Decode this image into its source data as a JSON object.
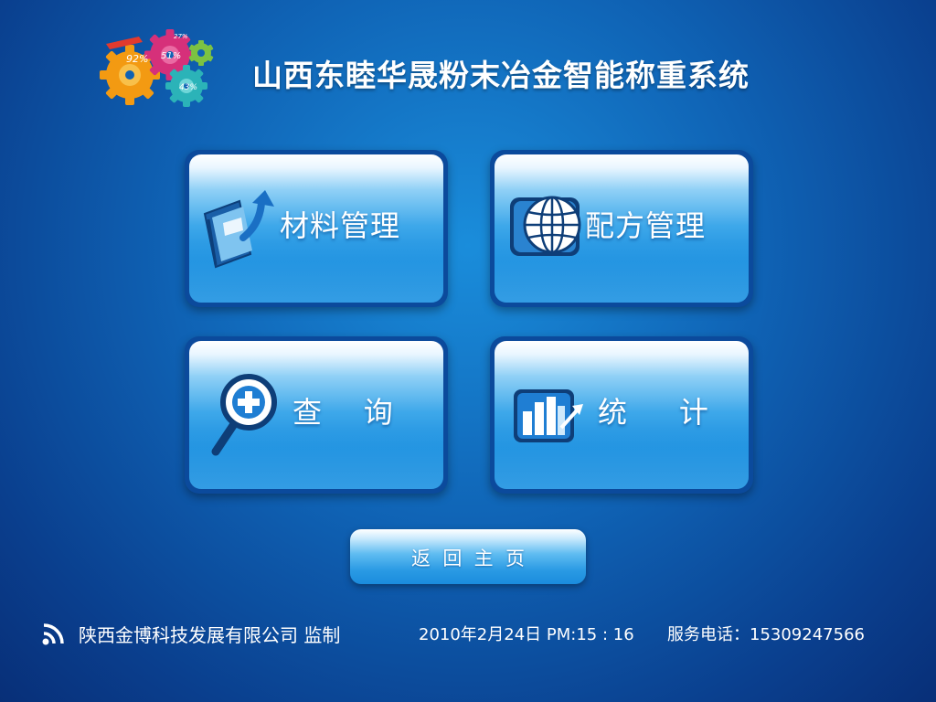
{
  "header": {
    "logo": {
      "gear_labels": [
        "92%",
        "51%",
        "43%",
        "27%"
      ]
    },
    "title": "山西东睦华晟粉末冶金智能称重系统"
  },
  "menu": {
    "tiles": [
      {
        "label": "材料管理",
        "icon": "folder-arrow-icon"
      },
      {
        "label": "配方管理",
        "icon": "globe-icon"
      },
      {
        "label": "查    询",
        "icon": "magnifier-plus-icon"
      },
      {
        "label": "统     计",
        "icon": "bar-chart-icon"
      }
    ],
    "home_button": "返  回  主  页"
  },
  "footer": {
    "icon": "rss-icon",
    "company": "陕西金博科技发展有限公司  监制",
    "datetime": "2010年2月24日  PM:15 : 16",
    "phone": "服务电话：15309247566"
  }
}
